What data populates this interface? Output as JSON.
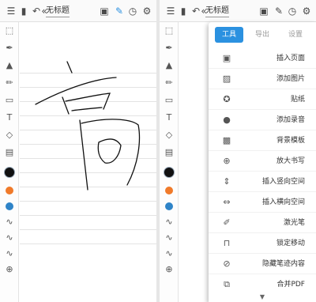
{
  "left_screen": {
    "title": "无标题",
    "toolbar_icons": [
      "menu-icon",
      "notebook-icon",
      "undo-icon",
      "collapse-icon"
    ],
    "right_icons": [
      "page-add-icon",
      "pen-icon",
      "clock-icon",
      "gear-icon"
    ],
    "sidebar_icons": [
      "select-icon",
      "pen-icon",
      "marker-icon",
      "pencil-icon",
      "eraser-icon",
      "text-icon",
      "shapes-icon",
      "sticker-icon"
    ],
    "colors": [
      "#111111",
      "#f07a2a",
      "#2f84c8"
    ],
    "stroke_icons": [
      "stroke-thin-icon",
      "stroke-medium-icon",
      "stroke-thick-icon"
    ],
    "add_icon": "add-icon",
    "handwriting": "高"
  },
  "right_screen": {
    "title": "无标题",
    "tabs": [
      {
        "label": "工具",
        "active": true
      },
      {
        "label": "导出",
        "active": false
      },
      {
        "label": "设置",
        "active": false
      }
    ],
    "menu_items": [
      {
        "label": "插入页面",
        "icon": "insert-page-icon"
      },
      {
        "label": "添加图片",
        "icon": "image-icon"
      },
      {
        "label": "贴纸",
        "icon": "sticker-icon"
      },
      {
        "label": "添加录音",
        "icon": "microphone-icon"
      },
      {
        "label": "背景模板",
        "icon": "template-icon"
      },
      {
        "label": "放大书写",
        "icon": "zoom-icon"
      },
      {
        "label": "插入竖向空间",
        "icon": "vertical-space-icon"
      },
      {
        "label": "插入横向空间",
        "icon": "horizontal-space-icon"
      },
      {
        "label": "激光笔",
        "icon": "laser-icon"
      },
      {
        "label": "锁定移动",
        "icon": "lock-icon"
      },
      {
        "label": "隐藏笔迹内容",
        "icon": "hide-icon"
      },
      {
        "label": "合并PDF",
        "icon": "merge-pdf-icon"
      }
    ],
    "more_icon": "chevron-down-icon",
    "accent": "#2b91e0"
  }
}
